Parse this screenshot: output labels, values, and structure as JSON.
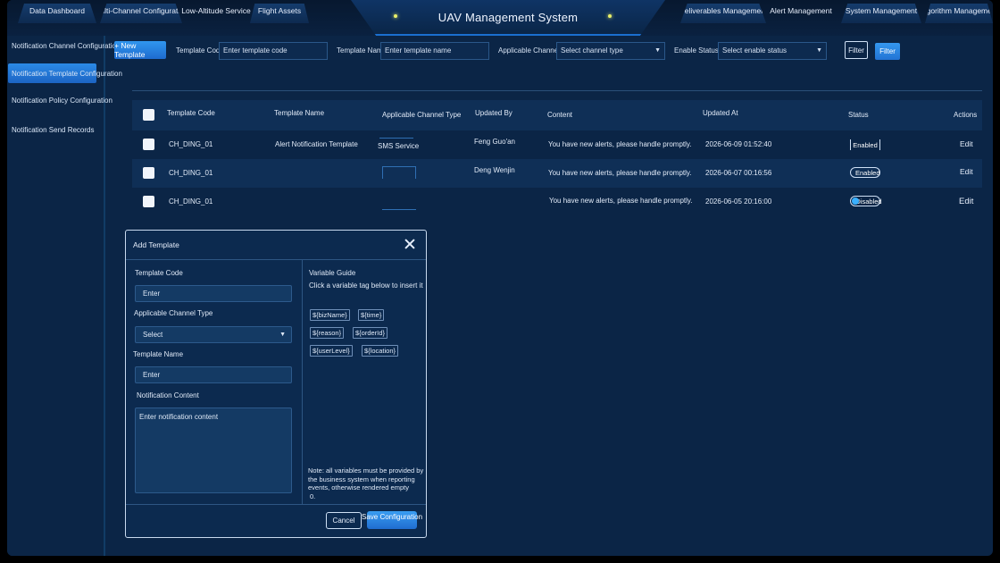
{
  "header": {
    "title": "UAV Management System",
    "nav_left": [
      "Data Dashboard",
      "Multi-Channel Configuration",
      "Low-Altitude Service",
      "Flight Assets"
    ],
    "nav_right": [
      "Deliverables Management",
      "Alert Management",
      "System Management",
      "Algorithm Management"
    ]
  },
  "sidebar": {
    "items": [
      {
        "label": "Notification Channel Configuration",
        "active": false
      },
      {
        "label": "Notification Template Configuration",
        "active": true
      },
      {
        "label": "Notification Policy Configuration",
        "active": false
      },
      {
        "label": "Notification Send Records",
        "active": false
      }
    ]
  },
  "filters": {
    "new_button": "+ New Template",
    "template_code_label": "Template Code",
    "template_code_placeholder": "Enter template code",
    "template_name_label": "Template Name",
    "template_name_placeholder": "Enter template name",
    "channel_label": "Applicable Channel Type",
    "channel_placeholder": "Select channel type",
    "status_label": "Enable Status:",
    "status_placeholder": "Select enable status",
    "filter_outline": "Filter",
    "filter_primary": "Filter"
  },
  "table": {
    "columns": [
      "Template Code",
      "Template Name",
      "Applicable Channel Type",
      "Updated By",
      "Content",
      "Updated At",
      "Status",
      "Actions"
    ],
    "rows": [
      {
        "code": "CH_DING_01",
        "name": "Alert Notification Template",
        "channel": "SMS Service",
        "updated_by": "Feng Guo'an",
        "content": "You have new alerts, please handle promptly.",
        "updated_at": "2026-06-09 01:52:40",
        "status": "Enabled",
        "action": "Edit"
      },
      {
        "code": "CH_DING_01",
        "name": "",
        "channel": "",
        "updated_by": "Deng Wenjin",
        "content": "You have new alerts, please handle promptly.",
        "updated_at": "2026-06-07 00:16:56",
        "status": "Enabled",
        "action": "Edit"
      },
      {
        "code": "CH_DING_01",
        "name": "",
        "channel": "",
        "updated_by": "",
        "content": "You have new alerts, please handle promptly.",
        "updated_at": "2026-06-05 20:16:00",
        "status": "Disabled",
        "action": "Edit"
      }
    ]
  },
  "modal": {
    "title": "Add Template",
    "code_label": "Template Code",
    "code_placeholder": "Enter",
    "channel_label": "Applicable Channel Type",
    "channel_placeholder": "Select",
    "name_label": "Template Name",
    "name_placeholder": "Enter",
    "content_label": "Notification Content",
    "content_placeholder": "Enter notification content",
    "guide_title": "Variable Guide",
    "guide_hint": "Click a variable tag below to insert it",
    "tags": [
      "${bizName}",
      "${time}",
      "${reason}",
      "${orderId}",
      "${userLevel}",
      "${location}"
    ],
    "note": "Note: all variables must be provided by the business system when reporting events, otherwise rendered empty",
    "note_tail": "0.",
    "cancel": "Cancel",
    "save": "Save Configuration"
  },
  "colors": {
    "background": "#0b2546",
    "accent": "#2b8ae6",
    "toggle_knob": "#3ab0ff"
  }
}
